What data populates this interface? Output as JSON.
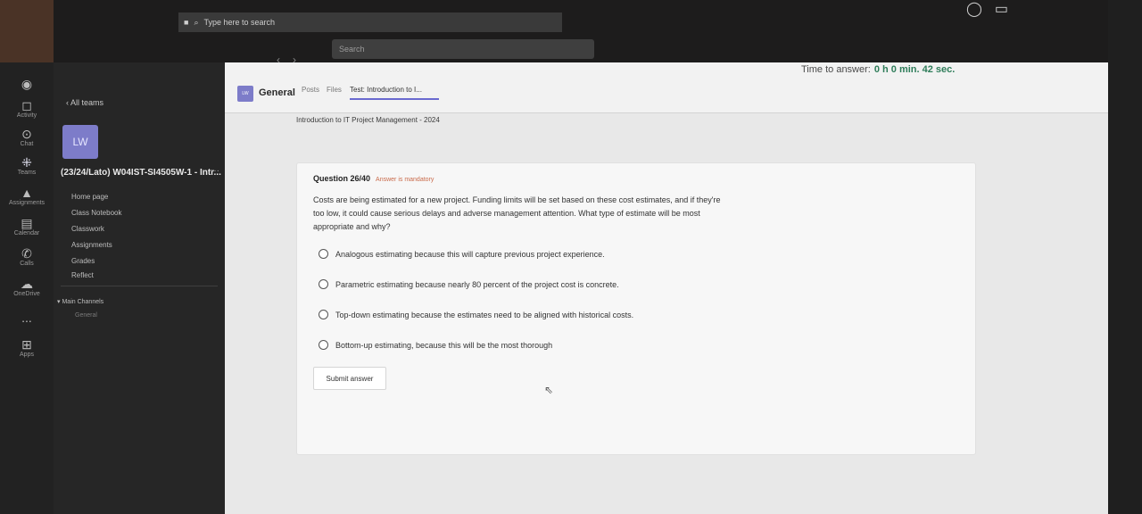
{
  "taskbar": {
    "search_placeholder": "Type here to search"
  },
  "window": {
    "search_placeholder": "Search"
  },
  "rail": [
    {
      "label": "Activity",
      "icon": "bell-icon"
    },
    {
      "label": "Chat",
      "icon": "chat-icon"
    },
    {
      "label": "Teams",
      "icon": "teams-icon"
    },
    {
      "label": "Assignments",
      "icon": "assignments-icon"
    },
    {
      "label": "Calendar",
      "icon": "calendar-icon"
    },
    {
      "label": "Calls",
      "icon": "phone-icon"
    },
    {
      "label": "OneDrive",
      "icon": "cloud-icon"
    },
    {
      "label": "...",
      "icon": "more-icon"
    },
    {
      "label": "Apps",
      "icon": "apps-icon"
    }
  ],
  "sidebar": {
    "back_label": "All teams",
    "team_initials": "LW",
    "team_name": "(23/24/Lato) W04IST-SI4505W-1 - Intr...",
    "more": "···",
    "nav": [
      "Home page",
      "Class Notebook",
      "Classwork",
      "Assignments",
      "Grades",
      "Reflect"
    ],
    "channels_heading": "Main Channels",
    "channel": "General"
  },
  "header": {
    "avatar_initials": "LW",
    "title": "General",
    "tabs": [
      "Posts",
      "Files",
      "Test: Introduction to I..."
    ],
    "timer_label": "Time to answer:",
    "timer_value": "0 h 0 min. 42 sec."
  },
  "content": {
    "breadcrumb": "Introduction to IT Project Management - 2024",
    "question_number": "Question 26/40",
    "required_note": "Answer is mandatory",
    "question_text": "Costs are being estimated for a new project. Funding limits will be set based on these cost estimates, and if they're too low, it could cause serious delays and adverse management attention. What type of estimate will be most appropriate and why?",
    "options": [
      "Analogous estimating because this will capture previous project experience.",
      "Parametric estimating because nearly 80 percent of the project cost is concrete.",
      "Top-down estimating because the estimates need to be aligned with historical costs.",
      "Bottom-up estimating, because this will be the most thorough"
    ],
    "submit_label": "Submit answer"
  }
}
